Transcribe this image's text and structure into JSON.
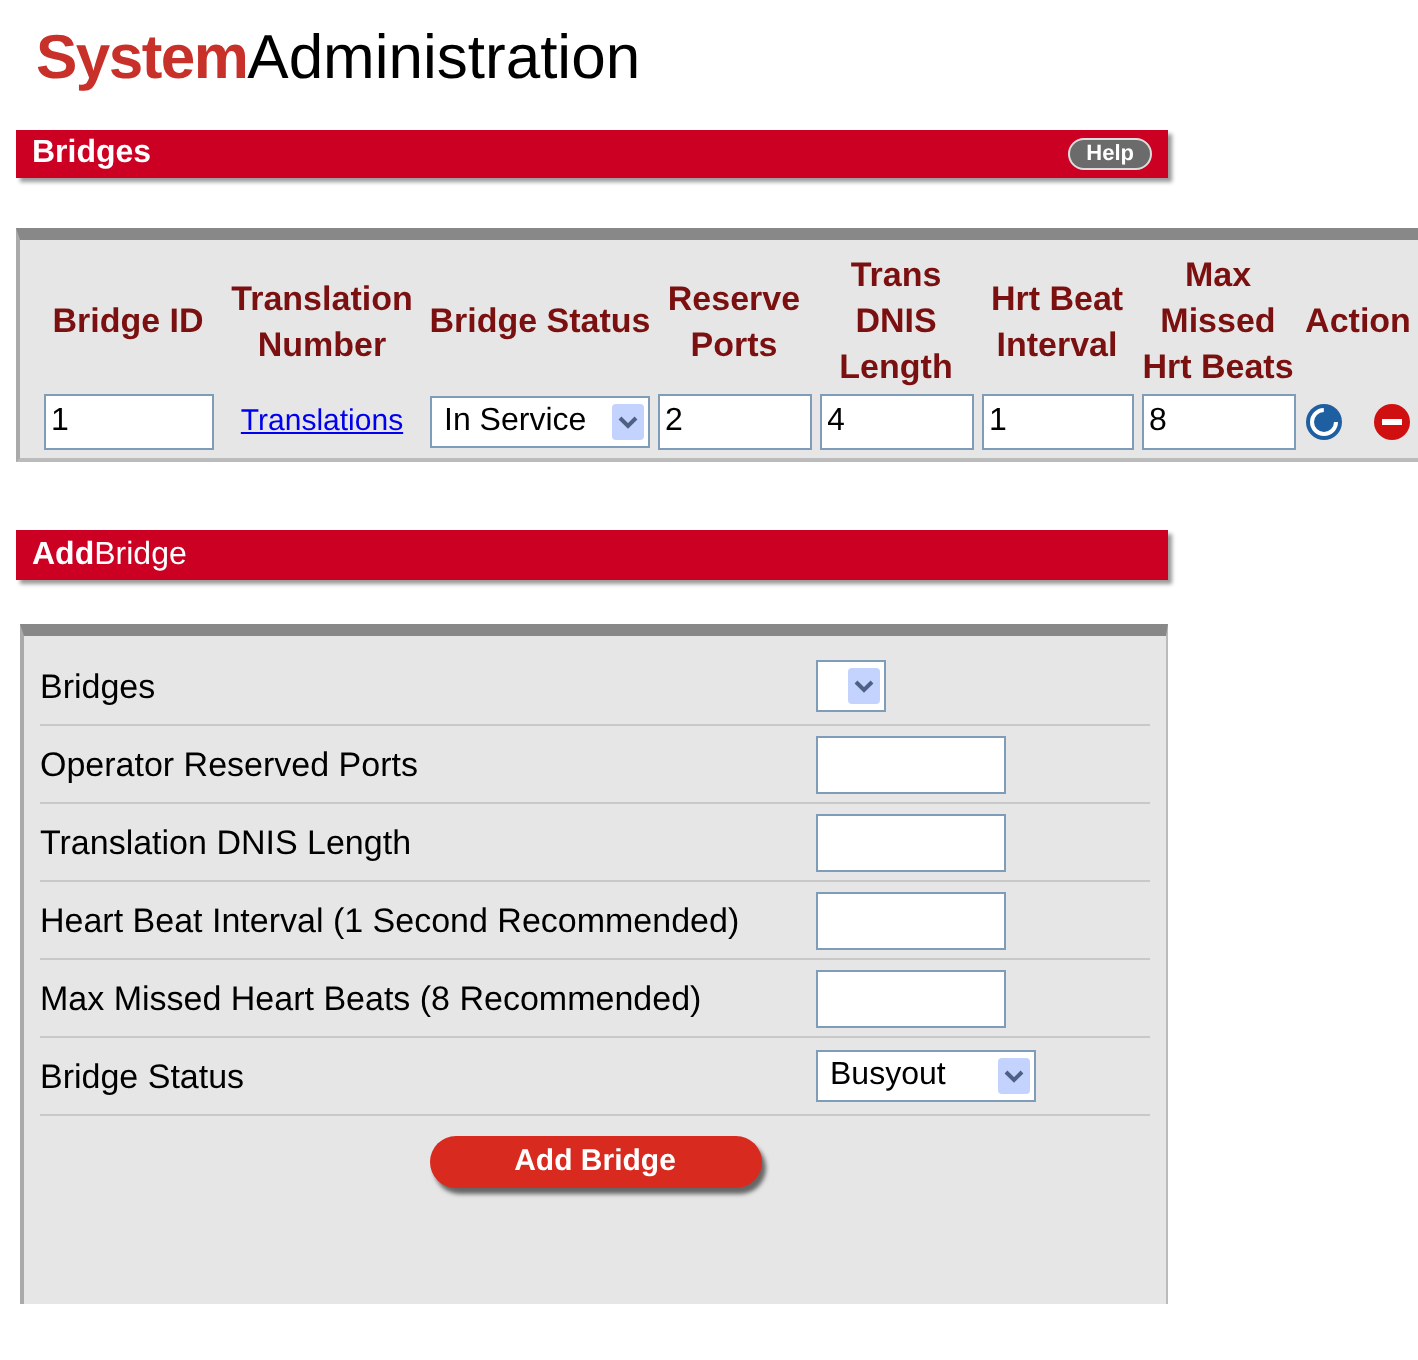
{
  "title": {
    "highlight": "System",
    "rest": "Administration"
  },
  "bridges_section": {
    "header": "Bridges",
    "help_button": "Help"
  },
  "table": {
    "columns": [
      "Bridge ID",
      "Translation Number",
      "Bridge Status",
      "Reserve Ports",
      "Trans DNIS Length",
      "Hrt Beat Interval",
      "Max Missed Hrt Beats",
      "Action"
    ],
    "rows": [
      {
        "cells": [
          {
            "kind": "input",
            "value": "1"
          },
          {
            "kind": "link",
            "text": "Translations"
          },
          {
            "kind": "select",
            "value": "In Service"
          },
          {
            "kind": "input",
            "value": "2"
          },
          {
            "kind": "input",
            "value": "4"
          },
          {
            "kind": "input",
            "value": "1"
          },
          {
            "kind": "input",
            "value": "8"
          },
          {
            "kind": "actions"
          }
        ]
      }
    ]
  },
  "add_section": {
    "header": "**Add**Bridge",
    "fields": [
      {
        "label": "Bridges",
        "kind": "select"
      },
      {
        "label": "Operator Reserved Ports",
        "kind": "input"
      },
      {
        "label": "Translation DNIS Length",
        "kind": "input"
      },
      {
        "label": "Heart Beat Interval (1 Second Recommended)",
        "kind": "input"
      },
      {
        "label": "Max Missed Heart Beats (8 Recommended)",
        "kind": "input"
      },
      {
        "label": "Bridge Status",
        "kind": "select",
        "value": "Busyout"
      }
    ],
    "button": "Add Bridge"
  }
}
